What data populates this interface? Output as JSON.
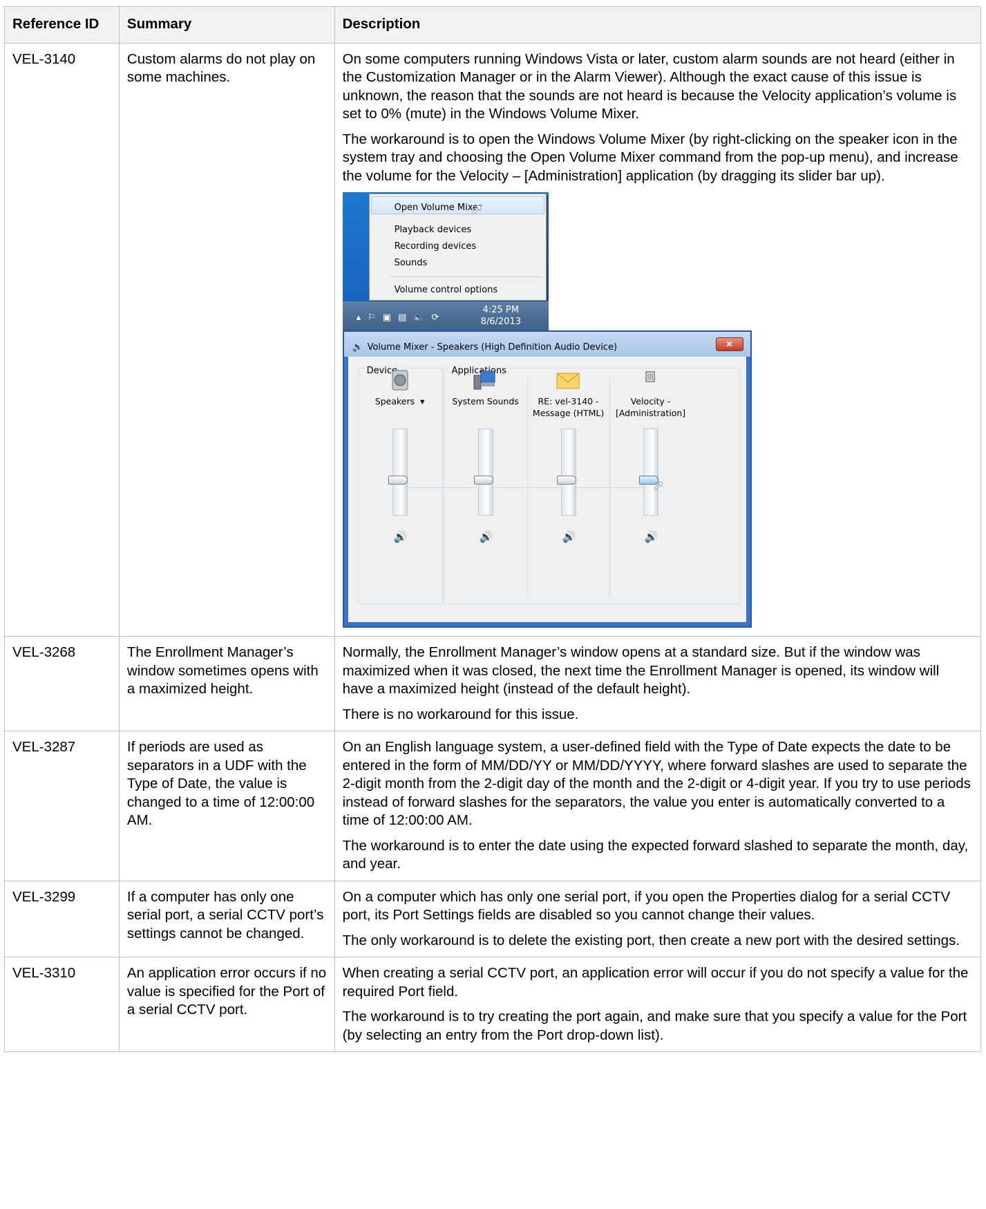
{
  "headers": {
    "ref": "Reference ID",
    "summary": "Summary",
    "description": "Description"
  },
  "rows": [
    {
      "id": "VEL-3140",
      "summary": "Custom alarms do not play on some machines.",
      "paragraphs": [
        "On some computers running Windows Vista or later, custom alarm sounds are not heard (either in the Customization Manager or in the Alarm Viewer).  Although the exact cause of this issue is unknown, the reason that the sounds are not heard is because the Velocity application’s volume is set to 0% (mute) in the Windows Volume Mixer.",
        "The workaround is to open the Windows Volume Mixer (by right-clicking on the speaker icon in the system tray and choosing the Open Volume Mixer command from the pop-up menu), and increase the volume for the Velocity – [Administration] application (by dragging its slider bar up)."
      ]
    },
    {
      "id": "VEL-3268",
      "summary": "The Enrollment Manager’s window sometimes opens with a maximized height.",
      "paragraphs": [
        "Normally, the Enrollment Manager’s window opens at a standard size.  But if the window was maximized when it was closed, the next time the Enrollment Manager is opened, its window will have a maximized height (instead of the default height).",
        "There is no workaround for this issue."
      ]
    },
    {
      "id": "VEL-3287",
      "summary": "If periods are used as separators in a UDF with the Type of Date, the value is changed to a time of 12:00:00 AM.",
      "paragraphs": [
        "On an English language system, a user-defined field with the Type of Date expects the date to be entered in the form of MM/DD/YY or MM/DD/YYYY, where forward slashes are used to separate the 2-digit month from the 2-digit day of the month and the 2-digit or 4-digit year.  If you try to use periods instead of forward slashes for the separators, the value you enter is automatically converted to a time of 12:00:00 AM.",
        "The workaround is to enter the date using the expected forward slashed to separate the month, day, and year."
      ]
    },
    {
      "id": "VEL-3299",
      "summary": "If a computer has only one serial port, a serial CCTV port’s settings cannot be changed.",
      "paragraphs": [
        "On a computer which has only one serial port, if you open the Properties dialog for a serial CCTV port, its Port Settings fields are disabled so you cannot change their values.",
        "The only workaround is to delete the existing port, then create a new port with the desired settings."
      ]
    },
    {
      "id": "VEL-3310",
      "summary": "An application error occurs if no value is specified for the Port of a serial CCTV port.",
      "paragraphs": [
        "When creating a serial CCTV port, an application error will occur if you do not specify a value for the required Port field.",
        "The workaround is to try creating the port again, and make sure that you specify a value for the Port (by selecting an entry from the Port drop-down list)."
      ]
    }
  ],
  "screenshot": {
    "context_menu": {
      "items": [
        "Open Volume Mixer",
        "Playback devices",
        "Recording devices",
        "Sounds",
        "Volume control options"
      ]
    },
    "clock": {
      "time": "4:25 PM",
      "date": "8/6/2013"
    },
    "mixer": {
      "title": "Volume Mixer - Speakers (High Definition Audio Device)",
      "device_group": "Device",
      "apps_group": "Applications",
      "channels": [
        {
          "name": "Speakers",
          "icon": "speaker-device-icon",
          "level": 0.4
        },
        {
          "name": "System Sounds",
          "icon": "system-sounds-icon",
          "level": 0.4
        },
        {
          "name": "RE: vel-3140 - Message (HTML)",
          "icon": "envelope-icon",
          "level": 0.4
        },
        {
          "name": "Velocity - [Administration]",
          "icon": "velocity-app-icon",
          "level": 0.4
        }
      ]
    },
    "colors": {
      "taskbar": "#3e5f86",
      "desktop": "#1a66c0",
      "mixer_frame": "#3a73c4",
      "speaker_glyph": "#1d6fd6"
    }
  }
}
